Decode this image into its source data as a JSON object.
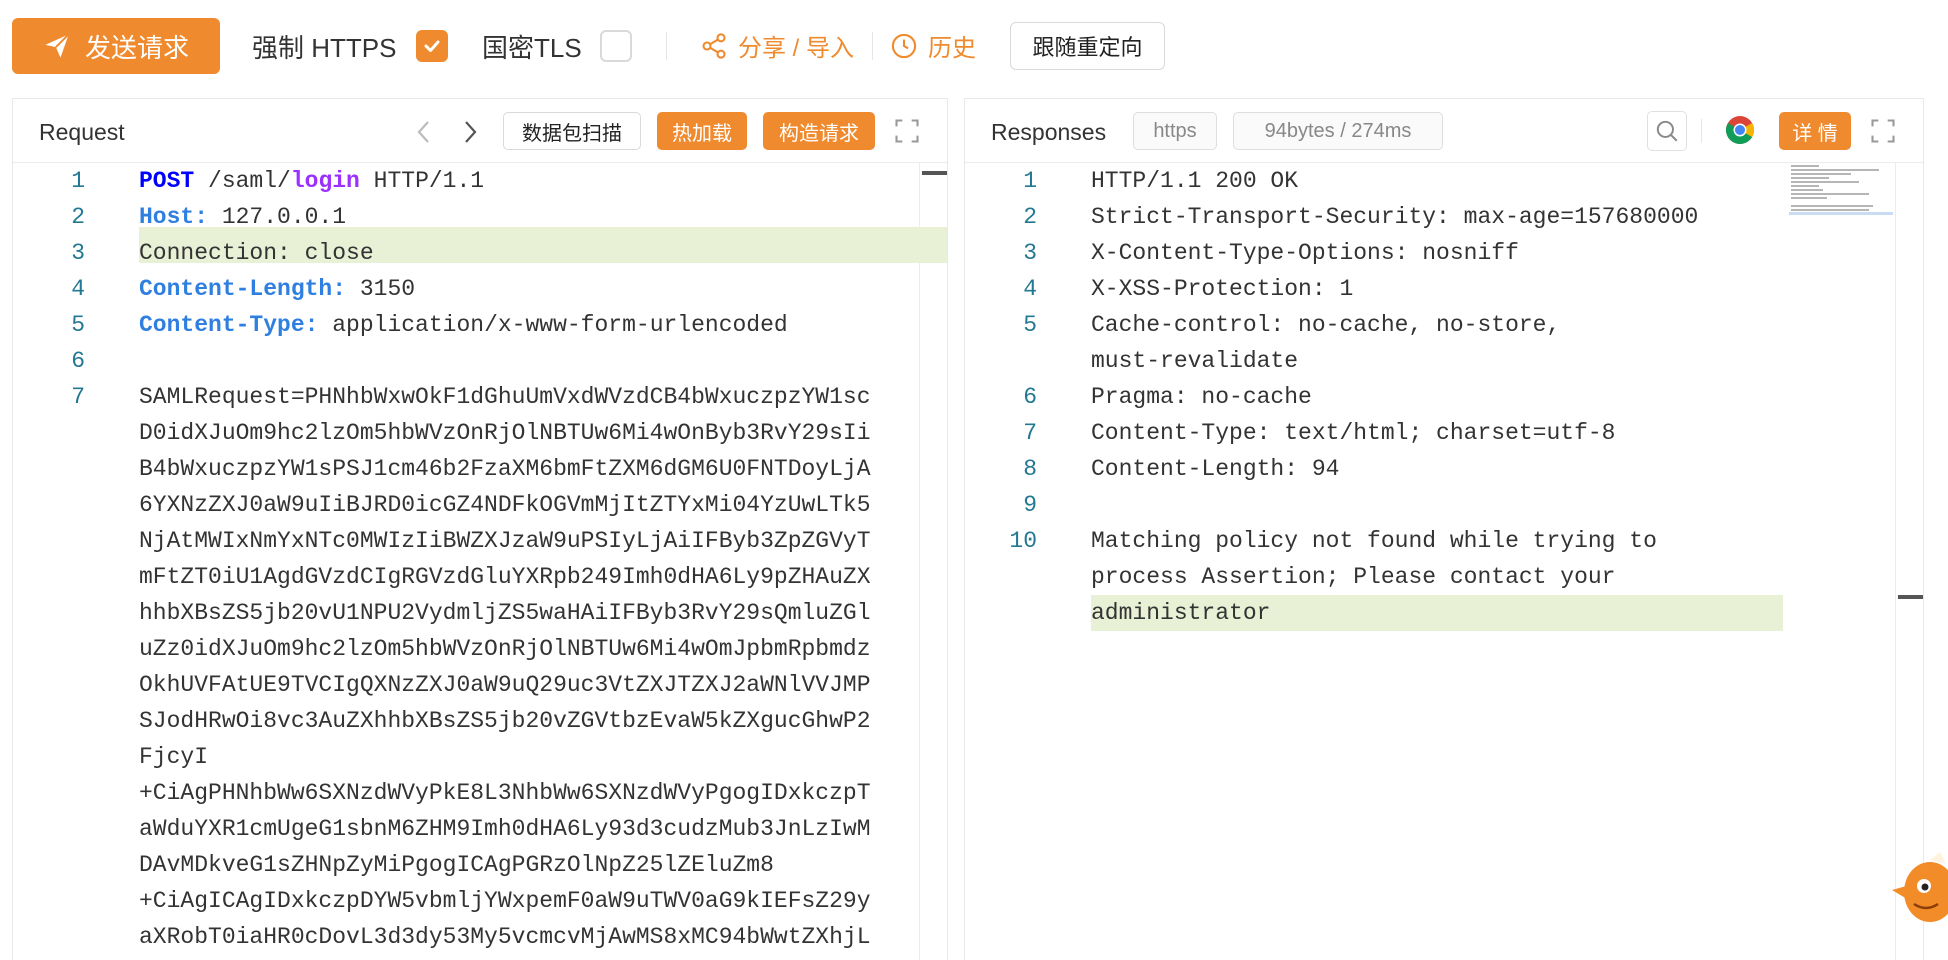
{
  "toolbar": {
    "send_label": "发送请求",
    "force_https_label": "强制 HTTPS",
    "force_https_checked": true,
    "gm_tls_label": "国密TLS",
    "gm_tls_checked": false,
    "share_label": "分享 / 导入",
    "history_label": "历史",
    "redirect_label": "跟随重定向",
    "icons": {
      "send": "paper-plane-icon",
      "share": "share-icon",
      "history": "clock-icon",
      "check": "check-icon"
    }
  },
  "request": {
    "title": "Request",
    "scan_label": "数据包扫描",
    "hot_reload_label": "热加载",
    "build_label": "构造请求",
    "line_numbers": [
      "1",
      "2",
      "3",
      "4",
      "5",
      "6",
      "7"
    ],
    "lines": [
      {
        "method": "POST",
        "path_a": " /saml/",
        "path_kw": "login",
        "path_b": " HTTP/1.1"
      },
      {
        "key": "Host:",
        "value": " 127.0.0.1"
      },
      {
        "plain": "Connection: close"
      },
      {
        "key": "Content-Length:",
        "value": " 3150"
      },
      {
        "key": "Content-Type:",
        "value": " application/x-www-form-urlencoded"
      },
      {
        "plain": ""
      },
      {
        "plain": "SAMLRequest=PHNhbWxwOkF1dGhuUmVxdWVzdCB4bWxuczpzYW1sc"
      }
    ],
    "body_wrapped": [
      "D0idXJuOm9hc2lzOm5hbWVzOnRjOlNBTUw6Mi4wOnByb3RvY29sIi",
      "B4bWxuczpzYW1sPSJ1cm46b2FzaXM6bmFtZXM6dGM6U0FNTDoyLjA",
      "6YXNzZXJ0aW9uIiBJRD0icGZ4NDFkOGVmMjItZTYxMi04YzUwLTk5",
      "NjAtMWIxNmYxNTc0MWIzIiBWZXJzaW9uPSIyLjAiIFByb3ZpZGVyT",
      "mFtZT0iU1AgdGVzdCIgRGVzdGluYXRpb249Imh0dHA6Ly9pZHAuZX",
      "hhbXBsZS5jb20vU1NPU2VydmljZS5waHAiIFByb3RvY29sQmluZGl",
      "uZz0idXJuOm9hc2lzOm5hbWVzOnRjOlNBTUw6Mi4wOmJpbmRpbmdz",
      "OkhUVFAtUE9TVCIgQXNzZXJ0aW9uQ29uc3VtZXJTZXJ2aWNlVVJMP",
      "SJodHRwOi8vc3AuZXhhbXBsZS5jb20vZGVtbzEvaW5kZXgucGhwP2",
      "FjcyI",
      "+CiAgPHNhbWw6SXNzdWVyPkE8L3NhbWw6SXNzdWVyPgogIDxkczpT",
      "aWduYXR1cmUgeG1sbnM6ZHM9Imh0dHA6Ly93d3cudzMub3JnLzIwM",
      "DAvMDkveG1sZHNpZyMiPgogICAgPGRzOlNpZ25lZEluZm8",
      "+CiAgICAgIDxkczpDYW5vbmljYWxpemF0aW9uTWV0aG9kIEFsZ29y",
      "aXRobT0iaHR0cDovL3d3dy53My5vcmcvMjAwMS8xMC94bWwtZXhjL"
    ]
  },
  "response": {
    "title": "Responses",
    "scheme_tag": "https",
    "stats_tag": "94bytes / 274ms",
    "detail_label": "详 情",
    "line_numbers": [
      "1",
      "2",
      "3",
      "4",
      "5",
      "",
      "6",
      "7",
      "8",
      "9",
      "10",
      "",
      ""
    ],
    "lines": [
      "HTTP/1.1 200 OK",
      "Strict-Transport-Security: max-age=157680000",
      "X-Content-Type-Options: nosniff",
      "X-XSS-Protection: 1",
      "Cache-control: no-cache, no-store,",
      "must-revalidate",
      "Pragma: no-cache",
      "Content-Type: text/html; charset=utf-8",
      "Content-Length: 94",
      "",
      "Matching policy not found while trying to",
      "process Assertion; Please contact your",
      "administrator"
    ],
    "icons": {
      "search": "search-icon",
      "browser": "chrome-icon",
      "fullscreen": "expand-icon"
    }
  },
  "colors": {
    "accent": "#ef8a2e",
    "line_highlight": "#e8f0d5",
    "line_number": "#237893",
    "header_key": "#2f7fe0"
  }
}
